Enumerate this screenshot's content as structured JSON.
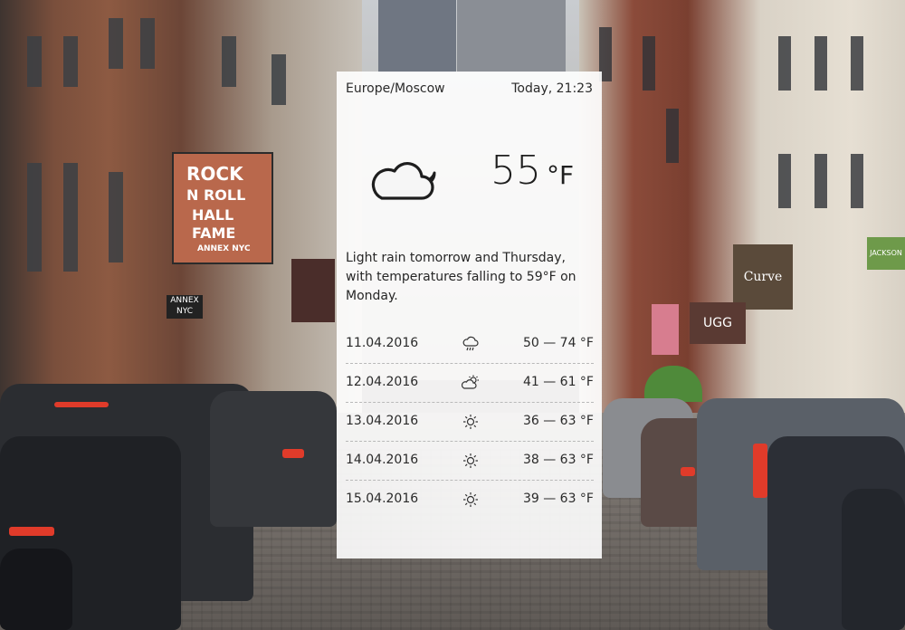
{
  "weather": {
    "location": "Europe/Moscow",
    "datetime": "Today, 21:23",
    "current": {
      "condition_icon": "cloud-moon-icon",
      "temperature": "55",
      "unit": "°F"
    },
    "summary": "Light rain tomorrow and Thursday, with temperatures falling to 59°F on Monday.",
    "forecast": [
      {
        "date": "11.04.2016",
        "icon": "rain-cloud-icon",
        "range": "50 — 74 °F"
      },
      {
        "date": "12.04.2016",
        "icon": "partly-cloudy-sun-icon",
        "range": "41 — 61 °F"
      },
      {
        "date": "13.04.2016",
        "icon": "sun-icon",
        "range": "36 — 63 °F"
      },
      {
        "date": "14.04.2016",
        "icon": "sun-icon",
        "range": "38 — 63 °F"
      },
      {
        "date": "15.04.2016",
        "icon": "sun-icon",
        "range": "39 — 63 °F"
      }
    ]
  },
  "background": {
    "signs": [
      "ROCK",
      "N ROLL",
      "HALL",
      "FAME",
      "ANNEX NYC",
      "ANNEX",
      "NYC",
      "Curve",
      "UGG",
      "JACKSON"
    ]
  }
}
